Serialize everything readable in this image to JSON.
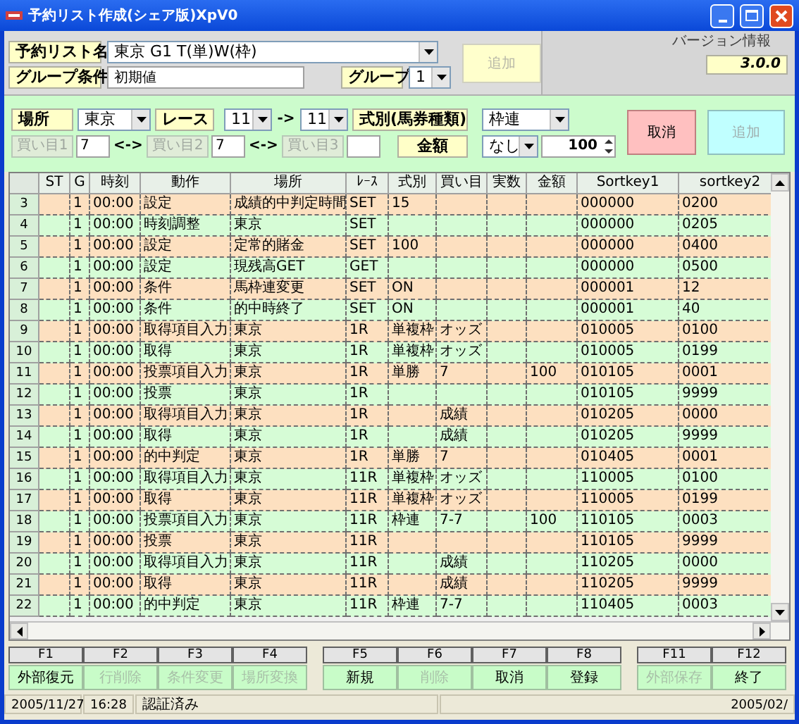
{
  "window": {
    "title": "予約リスト作成(シェア版)XpV0"
  },
  "list_name": {
    "label": "予約リスト名",
    "value": "東京  G1  T(単)W(枠)"
  },
  "group_condition": {
    "label": "グループ条件",
    "value": "初期値"
  },
  "group": {
    "label": "グループ",
    "value": "1"
  },
  "add_top": {
    "label": "追加",
    "disabled": true
  },
  "version": {
    "legend": "バージョン情報",
    "value": "3.0.0"
  },
  "place": {
    "label": "場所",
    "value": "東京"
  },
  "race": {
    "label": "レース",
    "from": "11",
    "arrow": "->",
    "to": "11"
  },
  "bet_type": {
    "label": "式別(馬券種類)",
    "value": "枠連"
  },
  "selections": [
    {
      "label": "買い目1",
      "disabled": true,
      "value": "7",
      "sep": "<->"
    },
    {
      "label": "買い目2",
      "disabled": true,
      "value": "7",
      "sep": "<->"
    },
    {
      "label": "買い目3",
      "disabled": true
    }
  ],
  "amount": {
    "label": "金額",
    "mode": "なし",
    "value": "100"
  },
  "cancel_button": {
    "label": "取消",
    "disabled": false
  },
  "add_button": {
    "label": "追加",
    "disabled": true
  },
  "table": {
    "columns": [
      "ST",
      "G",
      "時刻",
      "動作",
      "場所",
      "ﾚｰｽ",
      "式別",
      "買い目",
      "実数",
      "金額",
      "Sortkey1",
      "sortkey2"
    ],
    "rows": [
      {
        "row": "3",
        "g": "1",
        "time": "00:00",
        "action": "設定",
        "place": "成績的中判定時間",
        "race": "SET",
        "bet_type": "15",
        "sortkey1": "000000",
        "sortkey2": "0200"
      },
      {
        "row": "4",
        "g": "1",
        "time": "00:00",
        "action": "時刻調整",
        "place": "東京",
        "race": "SET",
        "sortkey1": "000000",
        "sortkey2": "0205"
      },
      {
        "row": "5",
        "g": "1",
        "time": "00:00",
        "action": "設定",
        "place": "定常的賭金",
        "race": "SET",
        "bet_type": "100",
        "sortkey1": "000000",
        "sortkey2": "0400"
      },
      {
        "row": "6",
        "g": "1",
        "time": "00:00",
        "action": "設定",
        "place": "現残高GET",
        "race": "GET",
        "sortkey1": "000000",
        "sortkey2": "0500"
      },
      {
        "row": "7",
        "g": "1",
        "time": "00:00",
        "action": "条件",
        "place": "馬枠連変更",
        "race": "SET",
        "bet_type": "ON",
        "sortkey1": "000001",
        "sortkey2": "12"
      },
      {
        "row": "8",
        "g": "1",
        "time": "00:00",
        "action": "条件",
        "place": "的中時終了",
        "race": "SET",
        "bet_type": "ON",
        "sortkey1": "000001",
        "sortkey2": "40"
      },
      {
        "row": "9",
        "g": "1",
        "time": "00:00",
        "action": "取得項目入力",
        "place": "東京",
        "race": "1R",
        "bet_type": "単複枠",
        "selection": "オッズ",
        "sortkey1": "010005",
        "sortkey2": "0100"
      },
      {
        "row": "10",
        "g": "1",
        "time": "00:00",
        "action": "取得",
        "place": "東京",
        "race": "1R",
        "bet_type": "単複枠",
        "selection": "オッズ",
        "sortkey1": "010005",
        "sortkey2": "0199"
      },
      {
        "row": "11",
        "g": "1",
        "time": "00:00",
        "action": "投票項目入力",
        "place": "東京",
        "race": "1R",
        "bet_type": "単勝",
        "selection": "7",
        "amount": "100",
        "sortkey1": "010105",
        "sortkey2": "0001"
      },
      {
        "row": "12",
        "g": "1",
        "time": "00:00",
        "action": "投票",
        "place": "東京",
        "race": "1R",
        "sortkey1": "010105",
        "sortkey2": "9999"
      },
      {
        "row": "13",
        "g": "1",
        "time": "00:00",
        "action": "取得項目入力",
        "place": "東京",
        "race": "1R",
        "selection": "成績",
        "sortkey1": "010205",
        "sortkey2": "0000"
      },
      {
        "row": "14",
        "g": "1",
        "time": "00:00",
        "action": "取得",
        "place": "東京",
        "race": "1R",
        "selection": "成績",
        "sortkey1": "010205",
        "sortkey2": "9999"
      },
      {
        "row": "15",
        "g": "1",
        "time": "00:00",
        "action": "的中判定",
        "place": "東京",
        "race": "1R",
        "bet_type": "単勝",
        "selection": "7",
        "sortkey1": "010405",
        "sortkey2": "0001"
      },
      {
        "row": "16",
        "g": "1",
        "time": "00:00",
        "action": "取得項目入力",
        "place": "東京",
        "race": "11R",
        "bet_type": "単複枠",
        "selection": "オッズ",
        "sortkey1": "110005",
        "sortkey2": "0100"
      },
      {
        "row": "17",
        "g": "1",
        "time": "00:00",
        "action": "取得",
        "place": "東京",
        "race": "11R",
        "bet_type": "単複枠",
        "selection": "オッズ",
        "sortkey1": "110005",
        "sortkey2": "0199"
      },
      {
        "row": "18",
        "g": "1",
        "time": "00:00",
        "action": "投票項目入力",
        "place": "東京",
        "race": "11R",
        "bet_type": "枠連",
        "selection": "7-7",
        "amount": "100",
        "sortkey1": "110105",
        "sortkey2": "0003"
      },
      {
        "row": "19",
        "g": "1",
        "time": "00:00",
        "action": "投票",
        "place": "東京",
        "race": "11R",
        "sortkey1": "110105",
        "sortkey2": "9999"
      },
      {
        "row": "20",
        "g": "1",
        "time": "00:00",
        "action": "取得項目入力",
        "place": "東京",
        "race": "11R",
        "selection": "成績",
        "sortkey1": "110205",
        "sortkey2": "0000"
      },
      {
        "row": "21",
        "g": "1",
        "time": "00:00",
        "action": "取得",
        "place": "東京",
        "race": "11R",
        "selection": "成績",
        "sortkey1": "110205",
        "sortkey2": "9999"
      },
      {
        "row": "22",
        "g": "1",
        "time": "00:00",
        "action": "的中判定",
        "place": "東京",
        "race": "11R",
        "bet_type": "枠連",
        "selection": "7-7",
        "sortkey1": "110405",
        "sortkey2": "0003"
      }
    ]
  },
  "function_keys": [
    [
      {
        "key": "F1",
        "label": "外部復元",
        "disabled": false
      },
      {
        "key": "F2",
        "label": "行削除",
        "disabled": true
      },
      {
        "key": "F3",
        "label": "条件変更",
        "disabled": true
      },
      {
        "key": "F4",
        "label": "場所変換",
        "disabled": true
      }
    ],
    [
      {
        "key": "F5",
        "label": "新規",
        "disabled": false
      },
      {
        "key": "F6",
        "label": "削除",
        "disabled": true
      },
      {
        "key": "F7",
        "label": "取消",
        "disabled": false
      },
      {
        "key": "F8",
        "label": "登録",
        "disabled": false
      }
    ],
    [
      {
        "key": "F11",
        "label": "外部保存",
        "disabled": true
      },
      {
        "key": "F12",
        "label": "終了",
        "disabled": false
      }
    ]
  ],
  "status_bar": {
    "date": "2005/11/27",
    "time": "16:28",
    "message": "認証済み",
    "right": "2005/02/"
  }
}
